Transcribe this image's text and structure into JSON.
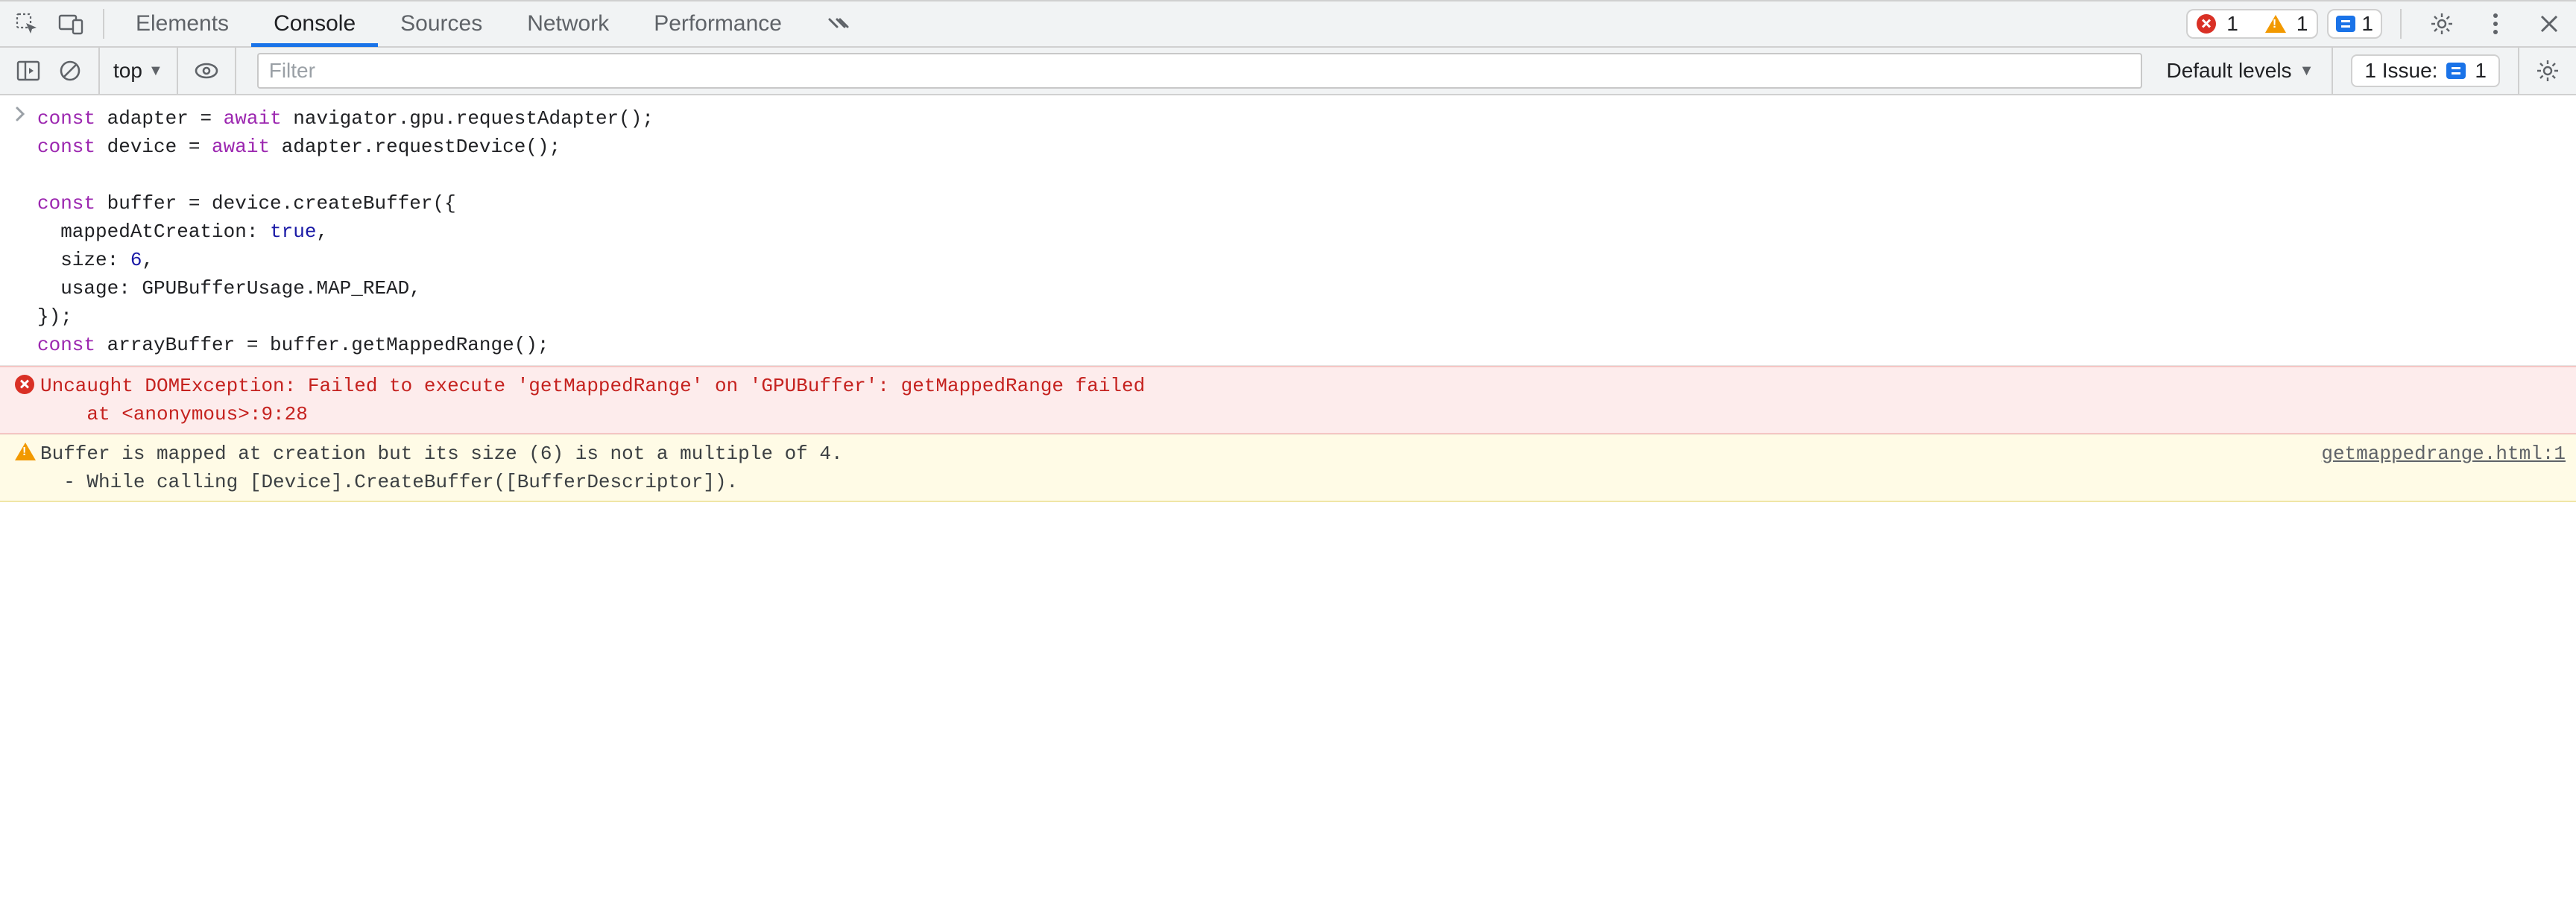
{
  "tabs": {
    "elements": "Elements",
    "console": "Console",
    "sources": "Sources",
    "network": "Network",
    "performance": "Performance"
  },
  "status": {
    "errors": "1",
    "warnings": "1",
    "info": "1"
  },
  "toolbar": {
    "context": "top",
    "filter_placeholder": "Filter",
    "levels": "Default levels",
    "issues_label": "1 Issue:",
    "issues_count": "1"
  },
  "input": {
    "prompt": "›",
    "code_tokens": [
      {
        "t": "kw",
        "v": "const"
      },
      {
        "t": "",
        "v": " adapter = "
      },
      {
        "t": "await",
        "v": "await"
      },
      {
        "t": "",
        "v": " navigator.gpu.requestAdapter();\n"
      },
      {
        "t": "kw",
        "v": "const"
      },
      {
        "t": "",
        "v": " device = "
      },
      {
        "t": "await",
        "v": "await"
      },
      {
        "t": "",
        "v": " adapter.requestDevice();\n\n"
      },
      {
        "t": "kw",
        "v": "const"
      },
      {
        "t": "",
        "v": " buffer = device.createBuffer({\n  mappedAtCreation: "
      },
      {
        "t": "boo",
        "v": "true"
      },
      {
        "t": "",
        "v": ",\n  size: "
      },
      {
        "t": "num",
        "v": "6"
      },
      {
        "t": "",
        "v": ",\n  usage: GPUBufferUsage.MAP_READ,\n});\n"
      },
      {
        "t": "kw",
        "v": "const"
      },
      {
        "t": "",
        "v": " arrayBuffer = buffer.getMappedRange();"
      }
    ]
  },
  "messages": {
    "error": {
      "line1": "Uncaught DOMException: Failed to execute 'getMappedRange' on 'GPUBuffer': getMappedRange failed",
      "line2": "    at <anonymous>:9:28"
    },
    "warning": {
      "line1": "Buffer is mapped at creation but its size (6) is not a multiple of 4.",
      "line2": "  - While calling [Device].CreateBuffer([BufferDescriptor]).",
      "source": "getmappedrange.html:1"
    }
  }
}
